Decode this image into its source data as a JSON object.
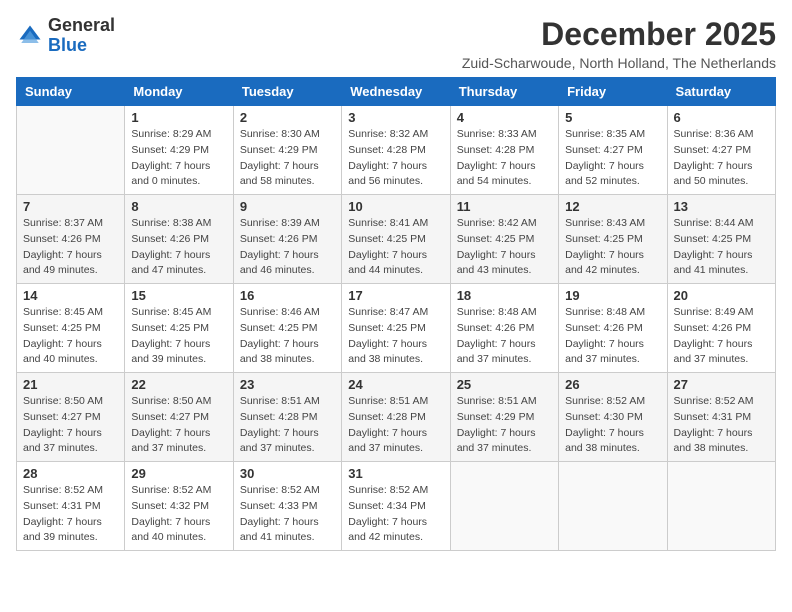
{
  "logo": {
    "general": "General",
    "blue": "Blue"
  },
  "title": "December 2025",
  "location": "Zuid-Scharwoude, North Holland, The Netherlands",
  "weekdays": [
    "Sunday",
    "Monday",
    "Tuesday",
    "Wednesday",
    "Thursday",
    "Friday",
    "Saturday"
  ],
  "weeks": [
    [
      {
        "day": "",
        "sunrise": "",
        "sunset": "",
        "daylight": ""
      },
      {
        "day": "1",
        "sunrise": "Sunrise: 8:29 AM",
        "sunset": "Sunset: 4:29 PM",
        "daylight": "Daylight: 7 hours and 0 minutes."
      },
      {
        "day": "2",
        "sunrise": "Sunrise: 8:30 AM",
        "sunset": "Sunset: 4:29 PM",
        "daylight": "Daylight: 7 hours and 58 minutes."
      },
      {
        "day": "3",
        "sunrise": "Sunrise: 8:32 AM",
        "sunset": "Sunset: 4:28 PM",
        "daylight": "Daylight: 7 hours and 56 minutes."
      },
      {
        "day": "4",
        "sunrise": "Sunrise: 8:33 AM",
        "sunset": "Sunset: 4:28 PM",
        "daylight": "Daylight: 7 hours and 54 minutes."
      },
      {
        "day": "5",
        "sunrise": "Sunrise: 8:35 AM",
        "sunset": "Sunset: 4:27 PM",
        "daylight": "Daylight: 7 hours and 52 minutes."
      },
      {
        "day": "6",
        "sunrise": "Sunrise: 8:36 AM",
        "sunset": "Sunset: 4:27 PM",
        "daylight": "Daylight: 7 hours and 50 minutes."
      }
    ],
    [
      {
        "day": "7",
        "sunrise": "Sunrise: 8:37 AM",
        "sunset": "Sunset: 4:26 PM",
        "daylight": "Daylight: 7 hours and 49 minutes."
      },
      {
        "day": "8",
        "sunrise": "Sunrise: 8:38 AM",
        "sunset": "Sunset: 4:26 PM",
        "daylight": "Daylight: 7 hours and 47 minutes."
      },
      {
        "day": "9",
        "sunrise": "Sunrise: 8:39 AM",
        "sunset": "Sunset: 4:26 PM",
        "daylight": "Daylight: 7 hours and 46 minutes."
      },
      {
        "day": "10",
        "sunrise": "Sunrise: 8:41 AM",
        "sunset": "Sunset: 4:25 PM",
        "daylight": "Daylight: 7 hours and 44 minutes."
      },
      {
        "day": "11",
        "sunrise": "Sunrise: 8:42 AM",
        "sunset": "Sunset: 4:25 PM",
        "daylight": "Daylight: 7 hours and 43 minutes."
      },
      {
        "day": "12",
        "sunrise": "Sunrise: 8:43 AM",
        "sunset": "Sunset: 4:25 PM",
        "daylight": "Daylight: 7 hours and 42 minutes."
      },
      {
        "day": "13",
        "sunrise": "Sunrise: 8:44 AM",
        "sunset": "Sunset: 4:25 PM",
        "daylight": "Daylight: 7 hours and 41 minutes."
      }
    ],
    [
      {
        "day": "14",
        "sunrise": "Sunrise: 8:45 AM",
        "sunset": "Sunset: 4:25 PM",
        "daylight": "Daylight: 7 hours and 40 minutes."
      },
      {
        "day": "15",
        "sunrise": "Sunrise: 8:45 AM",
        "sunset": "Sunset: 4:25 PM",
        "daylight": "Daylight: 7 hours and 39 minutes."
      },
      {
        "day": "16",
        "sunrise": "Sunrise: 8:46 AM",
        "sunset": "Sunset: 4:25 PM",
        "daylight": "Daylight: 7 hours and 38 minutes."
      },
      {
        "day": "17",
        "sunrise": "Sunrise: 8:47 AM",
        "sunset": "Sunset: 4:25 PM",
        "daylight": "Daylight: 7 hours and 38 minutes."
      },
      {
        "day": "18",
        "sunrise": "Sunrise: 8:48 AM",
        "sunset": "Sunset: 4:26 PM",
        "daylight": "Daylight: 7 hours and 37 minutes."
      },
      {
        "day": "19",
        "sunrise": "Sunrise: 8:48 AM",
        "sunset": "Sunset: 4:26 PM",
        "daylight": "Daylight: 7 hours and 37 minutes."
      },
      {
        "day": "20",
        "sunrise": "Sunrise: 8:49 AM",
        "sunset": "Sunset: 4:26 PM",
        "daylight": "Daylight: 7 hours and 37 minutes."
      }
    ],
    [
      {
        "day": "21",
        "sunrise": "Sunrise: 8:50 AM",
        "sunset": "Sunset: 4:27 PM",
        "daylight": "Daylight: 7 hours and 37 minutes."
      },
      {
        "day": "22",
        "sunrise": "Sunrise: 8:50 AM",
        "sunset": "Sunset: 4:27 PM",
        "daylight": "Daylight: 7 hours and 37 minutes."
      },
      {
        "day": "23",
        "sunrise": "Sunrise: 8:51 AM",
        "sunset": "Sunset: 4:28 PM",
        "daylight": "Daylight: 7 hours and 37 minutes."
      },
      {
        "day": "24",
        "sunrise": "Sunrise: 8:51 AM",
        "sunset": "Sunset: 4:28 PM",
        "daylight": "Daylight: 7 hours and 37 minutes."
      },
      {
        "day": "25",
        "sunrise": "Sunrise: 8:51 AM",
        "sunset": "Sunset: 4:29 PM",
        "daylight": "Daylight: 7 hours and 37 minutes."
      },
      {
        "day": "26",
        "sunrise": "Sunrise: 8:52 AM",
        "sunset": "Sunset: 4:30 PM",
        "daylight": "Daylight: 7 hours and 38 minutes."
      },
      {
        "day": "27",
        "sunrise": "Sunrise: 8:52 AM",
        "sunset": "Sunset: 4:31 PM",
        "daylight": "Daylight: 7 hours and 38 minutes."
      }
    ],
    [
      {
        "day": "28",
        "sunrise": "Sunrise: 8:52 AM",
        "sunset": "Sunset: 4:31 PM",
        "daylight": "Daylight: 7 hours and 39 minutes."
      },
      {
        "day": "29",
        "sunrise": "Sunrise: 8:52 AM",
        "sunset": "Sunset: 4:32 PM",
        "daylight": "Daylight: 7 hours and 40 minutes."
      },
      {
        "day": "30",
        "sunrise": "Sunrise: 8:52 AM",
        "sunset": "Sunset: 4:33 PM",
        "daylight": "Daylight: 7 hours and 41 minutes."
      },
      {
        "day": "31",
        "sunrise": "Sunrise: 8:52 AM",
        "sunset": "Sunset: 4:34 PM",
        "daylight": "Daylight: 7 hours and 42 minutes."
      },
      {
        "day": "",
        "sunrise": "",
        "sunset": "",
        "daylight": ""
      },
      {
        "day": "",
        "sunrise": "",
        "sunset": "",
        "daylight": ""
      },
      {
        "day": "",
        "sunrise": "",
        "sunset": "",
        "daylight": ""
      }
    ]
  ]
}
